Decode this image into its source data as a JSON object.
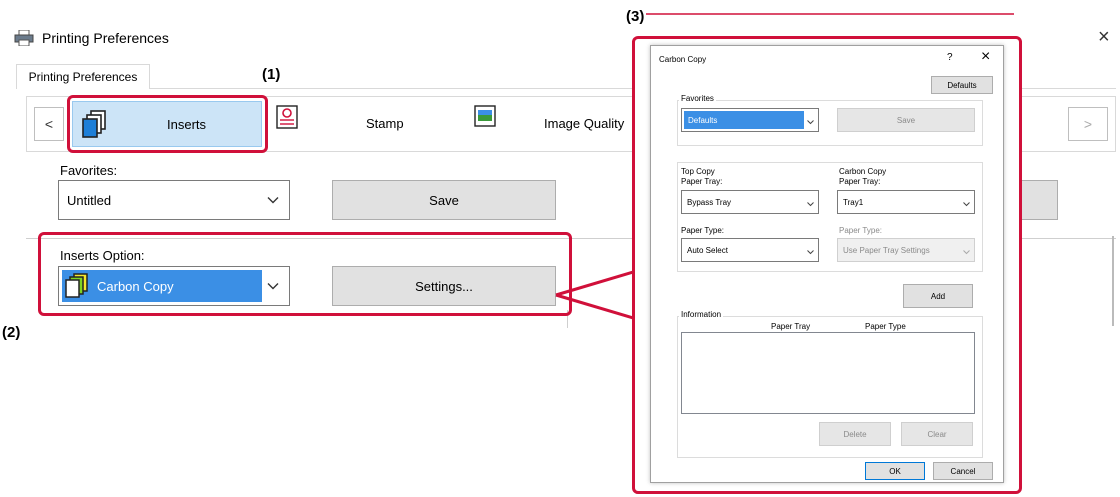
{
  "window": {
    "title": "Printing Preferences",
    "close_glyph": "×",
    "tab_label": "Printing Preferences"
  },
  "ribbon": {
    "prev_glyph": "<",
    "next_glyph": ">",
    "items": [
      {
        "label": "Inserts",
        "icon": "inserts-icon",
        "active": true
      },
      {
        "label": "Stamp",
        "icon": "stamp-icon",
        "active": false
      },
      {
        "label": "Image Quality",
        "icon": "image-quality-icon",
        "active": false
      }
    ]
  },
  "favorites": {
    "label": "Favorites:",
    "value": "Untitled",
    "save_label": "Save"
  },
  "inserts_option": {
    "label": "Inserts Option:",
    "value": "Carbon Copy",
    "settings_label": "Settings..."
  },
  "callouts": {
    "one": "(1)",
    "two": "(2)",
    "three": "(3)"
  },
  "dialog": {
    "title": "Carbon Copy",
    "help_glyph": "?",
    "close_glyph": "×",
    "defaults_label": "Defaults",
    "favorites": {
      "legend": "Favorites",
      "value": "Defaults",
      "save_label": "Save"
    },
    "top_copy": {
      "legend": "Top Copy",
      "paper_tray_label": "Paper Tray:",
      "paper_tray_value": "Bypass Tray",
      "paper_type_label": "Paper Type:",
      "paper_type_value": "Auto Select"
    },
    "carbon_copy": {
      "legend": "Carbon Copy",
      "paper_tray_label": "Paper Tray:",
      "paper_tray_value": "Tray1",
      "paper_type_label": "Paper Type:",
      "paper_type_value": "Use Paper Tray Settings"
    },
    "add_label": "Add",
    "information": {
      "legend": "Information",
      "col_tray": "Paper Tray",
      "col_type": "Paper Type"
    },
    "delete_label": "Delete",
    "clear_label": "Clear",
    "ok_label": "OK",
    "cancel_label": "Cancel"
  },
  "colors": {
    "accent": "#d0103a",
    "selection": "#3b8fe5",
    "ribbon_active": "#cce4f7"
  }
}
